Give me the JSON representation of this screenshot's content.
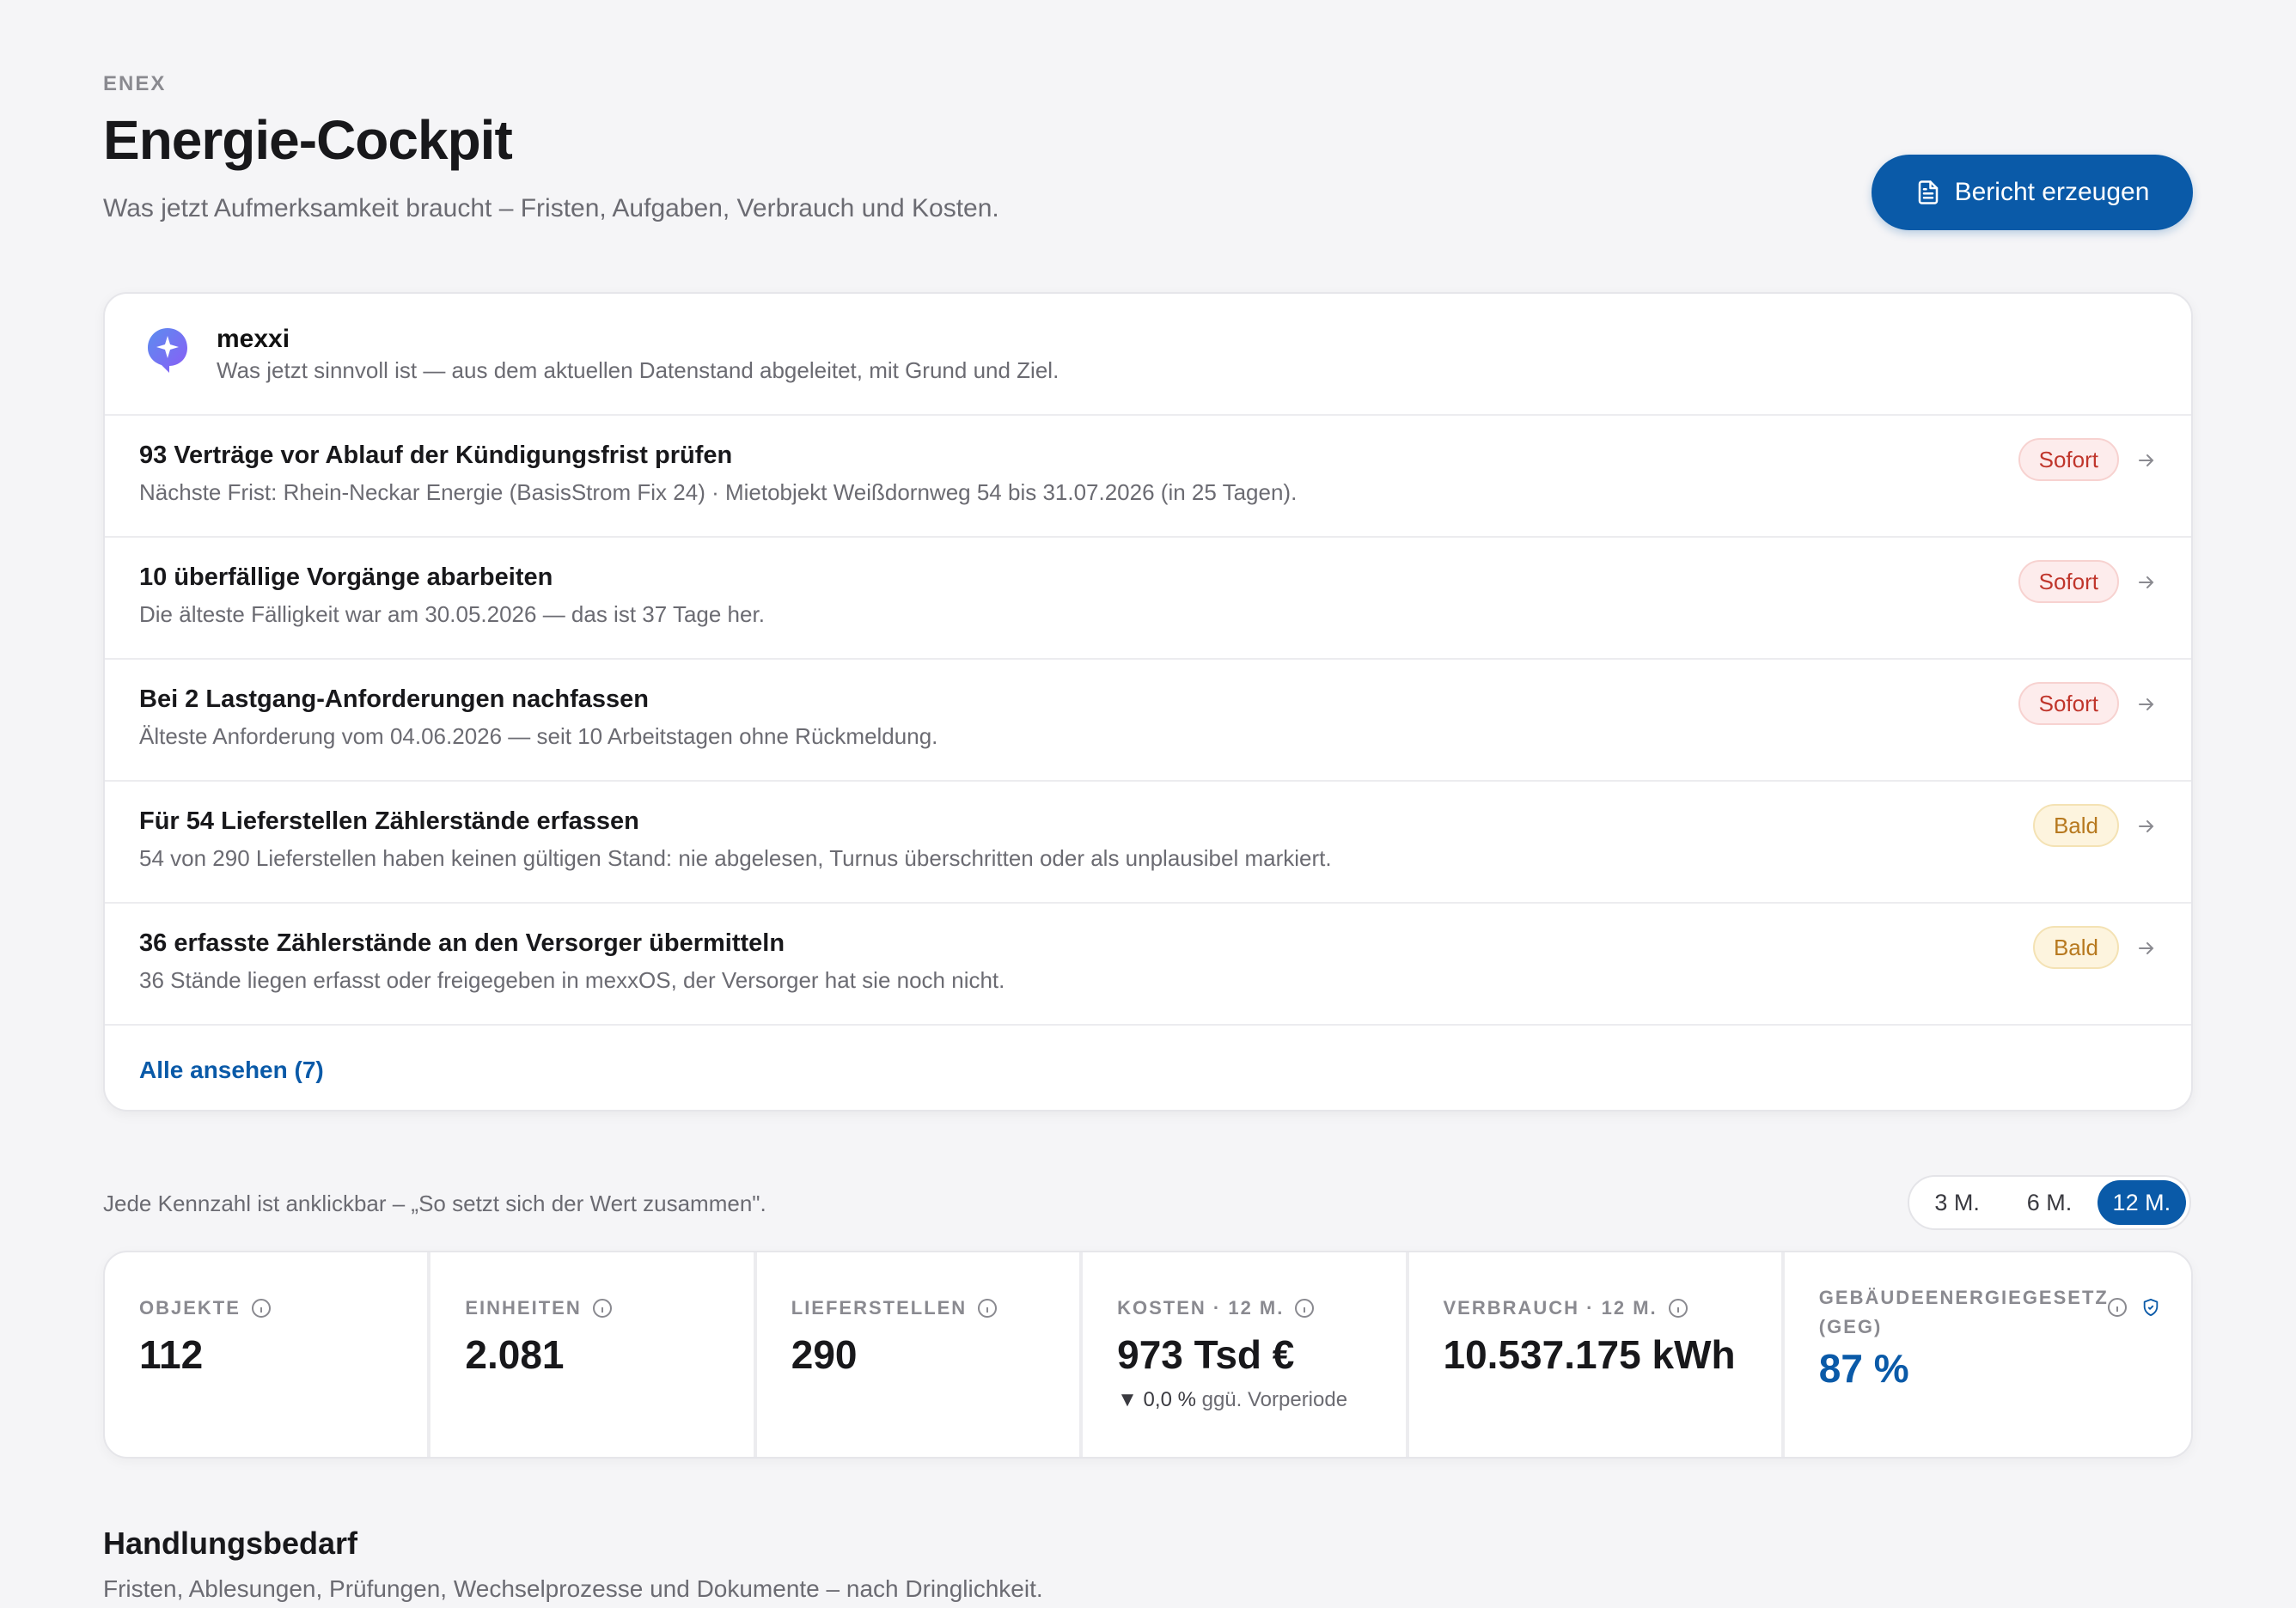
{
  "header": {
    "eyebrow": "ENEX",
    "title": "Energie-Cockpit",
    "subtitle": "Was jetzt Aufmerksamkeit braucht – Fristen, Aufgaben, Verbrauch und Kosten.",
    "report_button": "Bericht erzeugen"
  },
  "assistant": {
    "name": "mexxi",
    "description": "Was jetzt sinnvoll ist — aus dem aktuellen Datenstand abgeleitet, mit Grund und Ziel.",
    "tasks": [
      {
        "title": "93 Verträge vor Ablauf der Kündigungsfrist prüfen",
        "subtitle": "Nächste Frist: Rhein-Neckar Energie (BasisStrom Fix 24) · Mietobjekt Weißdornweg 54 bis 31.07.2026 (in 25 Tagen).",
        "badge": "Sofort"
      },
      {
        "title": "10 überfällige Vorgänge abarbeiten",
        "subtitle": "Die älteste Fälligkeit war am 30.05.2026 — das ist 37 Tage her.",
        "badge": "Sofort"
      },
      {
        "title": "Bei 2 Lastgang-Anforderungen nachfassen",
        "subtitle": "Älteste Anforderung vom 04.06.2026 — seit 10 Arbeitstagen ohne Rückmeldung.",
        "badge": "Sofort"
      },
      {
        "title": "Für 54 Lieferstellen Zählerstände erfassen",
        "subtitle": "54 von 290 Lieferstellen haben keinen gültigen Stand: nie abgelesen, Turnus überschritten oder als unplausibel markiert.",
        "badge": "Bald"
      },
      {
        "title": "36 erfasste Zählerstände an den Versorger übermitteln",
        "subtitle": "36 Stände liegen erfasst oder freigegeben in mexxOS, der Versorger hat sie noch nicht.",
        "badge": "Bald"
      }
    ],
    "view_all": "Alle ansehen (7)"
  },
  "kpi_hint": "Jede Kennzahl ist anklickbar – „So setzt sich der Wert zusammen\".",
  "period": {
    "options": [
      "3 M.",
      "6 M.",
      "12 M."
    ],
    "selected": "12 M."
  },
  "kpis": {
    "objekte": {
      "label": "OBJEKTE",
      "value": "112"
    },
    "einheiten": {
      "label": "EINHEITEN",
      "value": "2.081"
    },
    "lieferstellen": {
      "label": "LIEFERSTELLEN",
      "value": "290"
    },
    "kosten": {
      "label": "KOSTEN · 12 M.",
      "value": "973 Tsd €",
      "delta_value": "▼ 0,0 %",
      "delta_text": "ggü. Vorperiode"
    },
    "verbrauch": {
      "label": "VERBRAUCH · 12 M.",
      "value": "10.537.175 kWh"
    },
    "geg": {
      "label": "GEBÄUDEENERGIEGESETZ (GEG)",
      "value": "87 %"
    }
  },
  "section": {
    "title": "Handlungsbedarf",
    "subtitle": "Fristen, Ablesungen, Prüfungen, Wechselprozesse und Dokumente – nach Dringlichkeit."
  },
  "colors": {
    "accent": "#0a5aa8",
    "urgent_bg": "#fdecec",
    "urgent_text": "#c0362c",
    "soon_bg": "#fdf4de",
    "soon_text": "#b7791f"
  },
  "icons": {
    "report_button": "document-icon",
    "assistant": "sparkle-icon",
    "task_row": "arrow-right-icon",
    "kpi_info": "info-icon",
    "geg_badge": "shield-icon"
  }
}
